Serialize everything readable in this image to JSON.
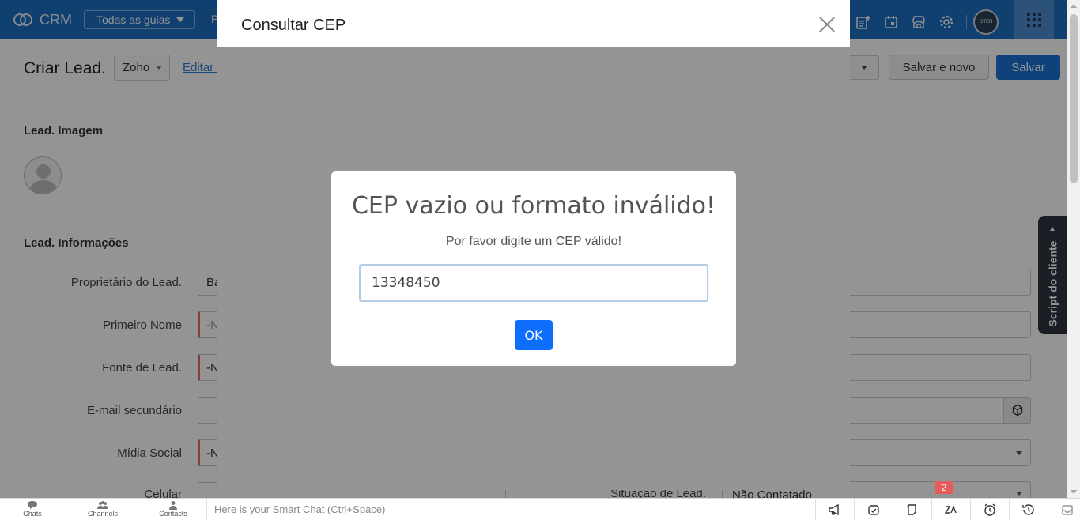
{
  "topnav": {
    "app_name": "CRM",
    "tabs_dropdown": "Todas as guias",
    "partial_tab": "P",
    "avatar_text": "OTEN",
    "icons": [
      "add-note-icon",
      "calendar-icon",
      "marketplace-icon",
      "settings-icon",
      "avatar-icon",
      "apps-grid-icon"
    ]
  },
  "header": {
    "title": "Criar Lead.",
    "layout_value": "Zoho",
    "edit_layout_link": "Editar Layout",
    "save_new_label": "Salvar e novo",
    "save_label": "Salvar"
  },
  "form": {
    "section_image": "Lead. Imagem",
    "section_info": "Lead. Informações",
    "fields": [
      {
        "label": "Proprietário do Lead.",
        "value": "Ba"
      },
      {
        "label": "Primeiro Nome",
        "value": "-N"
      },
      {
        "label": "Fonte de Lead.",
        "value": "-N"
      },
      {
        "label": "E-mail secundário",
        "value": ""
      },
      {
        "label": "Mídia Social",
        "value": "-N"
      }
    ],
    "celular_label": "Celular",
    "situacao_label": "Situação de Lead.",
    "situacao_value": "Não Contatado"
  },
  "side_tab": {
    "label": "Script do cliente"
  },
  "cep_dialog": {
    "title": "Consultar CEP"
  },
  "alert": {
    "title": "CEP vazio ou formato inválido!",
    "text": "Por favor digite um CEP válido!",
    "input_value": "13348450",
    "ok_label": "OK"
  },
  "bottombar": {
    "chats": "Chats",
    "channels": "Channels",
    "contacts": "Contacts",
    "smartchat_placeholder": "Here is your Smart Chat (Ctrl+Space)",
    "badge_count": "2"
  },
  "colors": {
    "nav_blue": "#1b6fc1",
    "save_blue": "#1a73d3",
    "ok_blue": "#0d6efd",
    "required_red": "#e56b6b",
    "badge_red": "#e65b5b"
  }
}
